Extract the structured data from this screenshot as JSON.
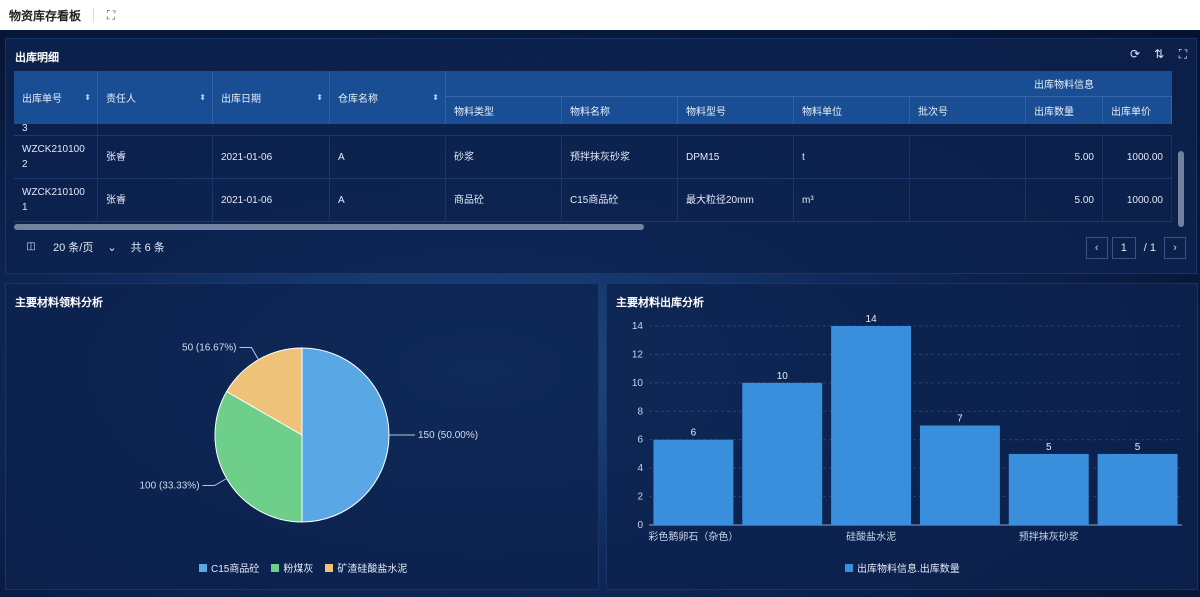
{
  "app": {
    "title": "物资库存看板",
    "expand_icon": "expand-icon"
  },
  "table_panel": {
    "title": "出库明细",
    "tools": [
      "refresh-icon",
      "column-settings-icon",
      "fullscreen-icon"
    ],
    "columns": [
      "出库单号",
      "责任人",
      "出库日期",
      "仓库名称"
    ],
    "group_header": "出库物料信息",
    "sub_columns": [
      "物料类型",
      "物料名称",
      "物料型号",
      "物料单位",
      "批次号",
      "出库数量",
      "出库单价"
    ],
    "partial_row_text": "3",
    "rows": [
      {
        "order_no": "WZCK2101002",
        "person": "张睿",
        "date": "2021-01-06",
        "warehouse": "A",
        "type": "砂浆",
        "name": "预拌抹灰砂浆",
        "model": "DPM15",
        "unit": "t",
        "batch": "",
        "qty": "5.00",
        "price": "1000.00"
      },
      {
        "order_no": "WZCK2101001",
        "person": "张睿",
        "date": "2021-01-06",
        "warehouse": "A",
        "type": "商品砼",
        "name": "C15商品砼",
        "model": "最大粒径20mm",
        "unit": "m³",
        "batch": "",
        "qty": "5.00",
        "price": "1000.00"
      }
    ],
    "pager": {
      "page_size": "20 条/页",
      "total": "共 6 条",
      "current": "1",
      "of": "/ 1"
    }
  },
  "pie_panel": {
    "title": "主要材料领料分析",
    "chart_data": {
      "type": "pie",
      "slices": [
        {
          "label": "C15商品砼",
          "value": 150,
          "text": "150 (50.00%)",
          "color": "#5aa7e6"
        },
        {
          "label": "粉煤灰",
          "value": 100,
          "text": "100 (33.33%)",
          "color": "#6dcf8a"
        },
        {
          "label": "矿渣硅酸盐水泥",
          "value": 50,
          "text": "50 (16.67%)",
          "color": "#efc27a"
        }
      ],
      "legend_placement": "bottom"
    }
  },
  "bar_panel": {
    "title": "主要材料出库分析",
    "chart_data": {
      "type": "bar",
      "values": [
        6,
        10,
        14,
        7,
        5,
        5
      ],
      "tick_labels": [
        "彩色鹅卵石（杂色）",
        "硅酸盐水泥",
        "预拌抹灰砂浆"
      ],
      "y_ticks": [
        "0",
        "2",
        "4",
        "6",
        "8",
        "10",
        "12",
        "14"
      ],
      "ylim": [
        0,
        14
      ],
      "legend": "出库物料信息.出库数量",
      "color": "#3a8fdc",
      "grid": true
    }
  }
}
